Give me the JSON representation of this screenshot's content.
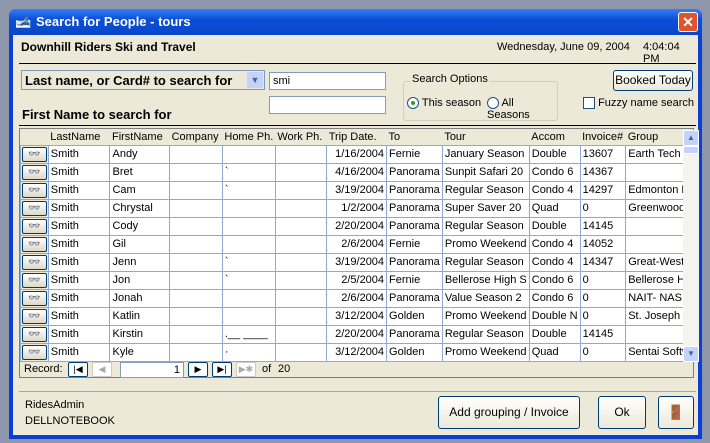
{
  "window": {
    "title": "Search for People - tours",
    "close": "✕"
  },
  "header": {
    "company": "Downhill Riders Ski and Travel",
    "date": "Wednesday, June 09, 2004",
    "time": "4:04:04 PM"
  },
  "search": {
    "mode_label": "Last name, or Card# to search for",
    "last_value": "smi",
    "first_label": "First Name to search for",
    "first_value": "",
    "options_title": "Search Options",
    "opt_this": "This season",
    "opt_all": "All Seasons",
    "selected": "This season",
    "booked_today": "Booked Today",
    "fuzzy_label": "Fuzzy name search",
    "fuzzy_checked": false
  },
  "grid": {
    "columns": [
      "LastName",
      "FirstName",
      "Company",
      "Home Ph.",
      "Work Ph.",
      "Trip Date.",
      "To",
      "Tour",
      "Accom",
      "Invoice#",
      "Group"
    ],
    "rows": [
      [
        "Smith",
        "Andy",
        "",
        "",
        "",
        "1/16/2004",
        "Fernie",
        "January Season",
        "Double",
        "13607",
        "Earth Tech"
      ],
      [
        "Smith",
        "Bret",
        "",
        "`",
        "",
        "4/16/2004",
        "Panorama",
        "Sunpit Safari 20",
        "Condo 6",
        "14367",
        ""
      ],
      [
        "Smith",
        "Cam",
        "",
        "`",
        "",
        "3/19/2004",
        "Panorama",
        "Regular Season",
        "Condo 4",
        "14297",
        "Edmonton F"
      ],
      [
        "Smith",
        "Chrystal",
        "",
        "",
        "",
        "1/2/2004",
        "Panorama",
        "Super Saver 20",
        "Quad",
        "0",
        "Greenwood"
      ],
      [
        "Smith",
        "Cody",
        "",
        "",
        "",
        "2/20/2004",
        "Panorama",
        "Regular Season",
        "Double",
        "14145",
        ""
      ],
      [
        "Smith",
        "Gil",
        "",
        "",
        "",
        "2/6/2004",
        "Fernie",
        "Promo Weekend",
        "Condo 4",
        "14052",
        ""
      ],
      [
        "Smith",
        "Jenn",
        "",
        "`",
        "",
        "3/19/2004",
        "Panorama",
        "Regular Season",
        "Condo 4",
        "14347",
        "Great-West"
      ],
      [
        "Smith",
        "Jon",
        "",
        "`",
        "",
        "2/5/2004",
        "Fernie",
        "Bellerose High S",
        "Condo 6",
        "0",
        "Bellerose H"
      ],
      [
        "Smith",
        "Jonah",
        "",
        "",
        "",
        "2/6/2004",
        "Panorama",
        "Value Season 2",
        "Condo 6",
        "0",
        "NAIT- NAS"
      ],
      [
        "Smith",
        "Katlin",
        "",
        "",
        "",
        "3/12/2004",
        "Golden",
        "Promo Weekend",
        "Double N",
        "0",
        "St. Joseph"
      ],
      [
        "Smith",
        "Kirstin",
        "",
        ".__ ____",
        "",
        "2/20/2004",
        "Panorama",
        "Regular Season",
        "Double",
        "14145",
        ""
      ],
      [
        "Smith",
        "Kyle",
        "",
        "·",
        "",
        "3/12/2004",
        "Golden",
        "Promo Weekend",
        "Quad",
        "0",
        "Sentai Softw"
      ]
    ]
  },
  "record_nav": {
    "label": "Record:",
    "current": "1",
    "of_label": "of",
    "total": "20"
  },
  "footer": {
    "user": "RidesAdmin",
    "machine": "DELLNOTEBOOK",
    "add_grouping": "Add grouping / Invoice",
    "ok": "Ok"
  }
}
